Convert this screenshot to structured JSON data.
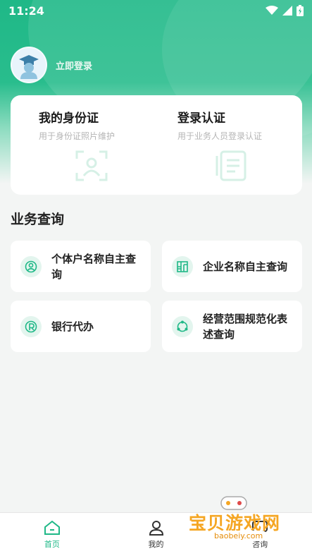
{
  "status_bar": {
    "time": "11:24"
  },
  "profile": {
    "login_label": "立即登录"
  },
  "cert_cards": [
    {
      "title": "我的身份证",
      "subtitle": "用于身份证照片维护",
      "icon": "id-portrait-icon"
    },
    {
      "title": "登录认证",
      "subtitle": "用于业务人员登录认证",
      "icon": "document-icon"
    }
  ],
  "section": {
    "title": "业务查询"
  },
  "services": [
    {
      "label": "个体户名称自主查询",
      "icon": "person-search-icon"
    },
    {
      "label": "企业名称自主查询",
      "icon": "building-icon"
    },
    {
      "label": "银行代办",
      "icon": "bank-icon"
    },
    {
      "label": "经营范围规范化表述查询",
      "icon": "cycle-icon"
    }
  ],
  "tabs": [
    {
      "label": "首页",
      "icon": "home-icon",
      "active": true
    },
    {
      "label": "我的",
      "icon": "person-icon",
      "active": false
    },
    {
      "label": "咨询",
      "icon": "chat-icon",
      "active": false
    }
  ],
  "watermark": {
    "text": "宝贝游戏网",
    "url": "baobeiy.com"
  },
  "colors": {
    "brand": "#1fb887",
    "background": "#f3f5f4"
  }
}
